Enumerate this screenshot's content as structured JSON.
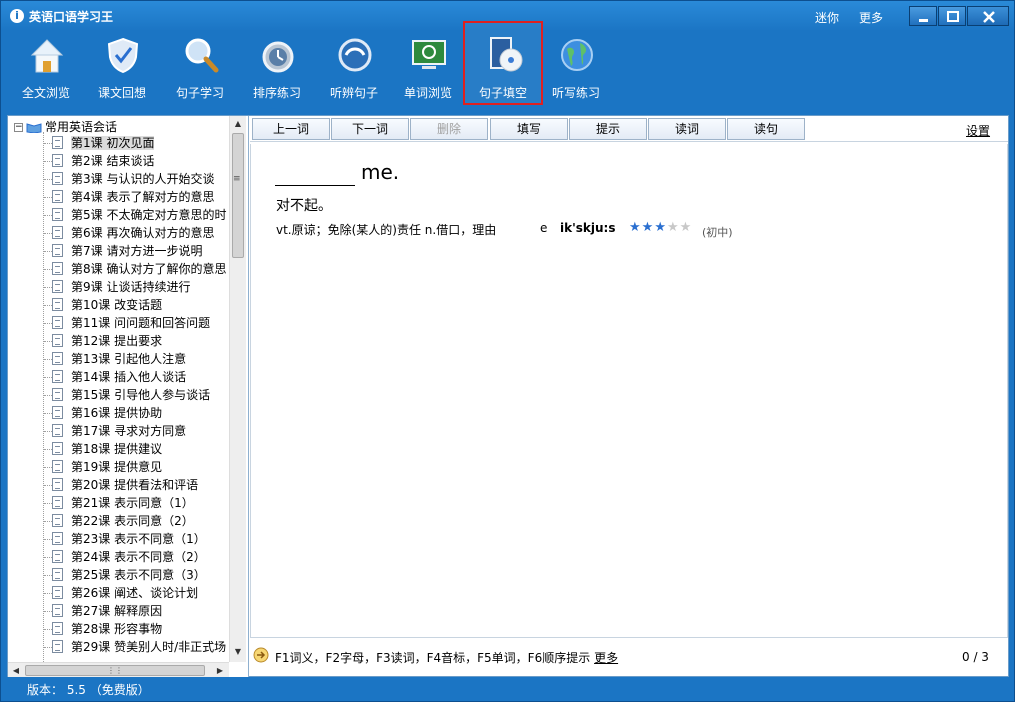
{
  "window": {
    "title": "英语口语学习王",
    "links": [
      "迷你",
      "更多"
    ]
  },
  "toolbar": {
    "tools": [
      {
        "label": "全文浏览",
        "icon": "home-icon"
      },
      {
        "label": "课文回想",
        "icon": "shield-icon"
      },
      {
        "label": "句子学习",
        "icon": "magnifier-icon"
      },
      {
        "label": "排序练习",
        "icon": "clock-icon"
      },
      {
        "label": "听辨句子",
        "icon": "play-icon"
      },
      {
        "label": "单词浏览",
        "icon": "monitor-icon"
      },
      {
        "label": "句子填空",
        "icon": "disc-icon"
      },
      {
        "label": "听写练习",
        "icon": "globe-icon"
      }
    ],
    "selected": "句子填空"
  },
  "tree": {
    "root": "常用英语会话",
    "selected_index": 0,
    "items": [
      "第1课 初次见面",
      "第2课 结束谈话",
      "第3课 与认识的人开始交谈",
      "第4课 表示了解对方的意思",
      "第5课 不太确定对方意思的时",
      "第6课 再次确认对方的意思",
      "第7课 请对方进一步说明",
      "第8课 确认对方了解你的意思",
      "第9课 让谈话持续进行",
      "第10课 改变话题",
      "第11课 问问题和回答问题",
      "第12课 提出要求",
      "第13课 引起他人注意",
      "第14课 插入他人谈话",
      "第15课 引导他人参与谈话",
      "第16课 提供协助",
      "第17课 寻求对方同意",
      "第18课 提供建议",
      "第19课 提供意见",
      "第20课 提供看法和评语",
      "第21课 表示同意（1）",
      "第22课 表示同意（2）",
      "第23课 表示不同意（1）",
      "第24课 表示不同意（2）",
      "第25课 表示不同意（3）",
      "第26课 阐述、谈论计划",
      "第27课 解释原因",
      "第28课 形容事物",
      "第29课 赞美别人时/非正式场"
    ]
  },
  "commands": {
    "buttons": [
      {
        "label": "上一词",
        "enabled": true
      },
      {
        "label": "下一词",
        "enabled": true
      },
      {
        "label": "删除",
        "enabled": false
      },
      {
        "label": "填写",
        "enabled": true
      },
      {
        "label": "提示",
        "enabled": true
      },
      {
        "label": "读词",
        "enabled": true
      },
      {
        "label": "读句",
        "enabled": true
      }
    ],
    "settings_label": "设置"
  },
  "exercise": {
    "sentence_tail": "me.",
    "translation": "对不起。",
    "definition": "vt.原谅；免除(某人的)责任 n.借口，理由",
    "first_letter": "e",
    "phonetic": "ik'skju:s",
    "star_level": 3,
    "star_max": 5,
    "level_label": "(初中)"
  },
  "status": {
    "hint_text": "F1词义，F2字母，F3读词，F4音标，F5单词，F6顺序提示",
    "hint_more": "更多",
    "progress": "0 / 3"
  },
  "footer": {
    "version": "版本： 5.5   （免费版）"
  },
  "colors": {
    "frame": "#1b75c4",
    "selection_box": "#e02020",
    "star": "#2a6fd0"
  }
}
